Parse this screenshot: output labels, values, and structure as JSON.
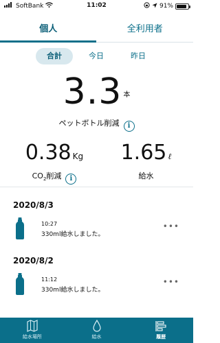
{
  "status_bar": {
    "carrier": "SoftBank",
    "time": "11:02",
    "battery": "91%",
    "battery_level": 0.91
  },
  "tabs": [
    {
      "label": "個人",
      "active": true
    },
    {
      "label": "全利用者",
      "active": false
    }
  ],
  "period_tabs": [
    {
      "label": "合計",
      "active": true
    },
    {
      "label": "今日",
      "active": false
    },
    {
      "label": "昨日",
      "active": false
    }
  ],
  "main_stat": {
    "value": "3.3",
    "unit": "本",
    "label": "ペットボトル削減"
  },
  "co2": {
    "value": "0.38",
    "unit": "Kg",
    "label_prefix": "CO",
    "label_sub": "2",
    "label_suffix": "削減"
  },
  "water": {
    "value": "1.65",
    "unit": "ℓ",
    "label": "給水"
  },
  "history": [
    {
      "date": "2020/8/3",
      "time": "10:27",
      "message": "330ml給水しました。"
    },
    {
      "date": "2020/8/2",
      "time": "11:12",
      "message": "330ml給水しました。"
    }
  ],
  "bottom_nav": [
    {
      "label": "給水場所",
      "icon": "map-icon",
      "active": false
    },
    {
      "label": "給水",
      "icon": "water-drop-icon",
      "active": false
    },
    {
      "label": "履歴",
      "icon": "history-icon",
      "active": true
    }
  ],
  "colors": {
    "accent": "#0b6f8a",
    "segment_active_bg": "#d8e8ee"
  }
}
